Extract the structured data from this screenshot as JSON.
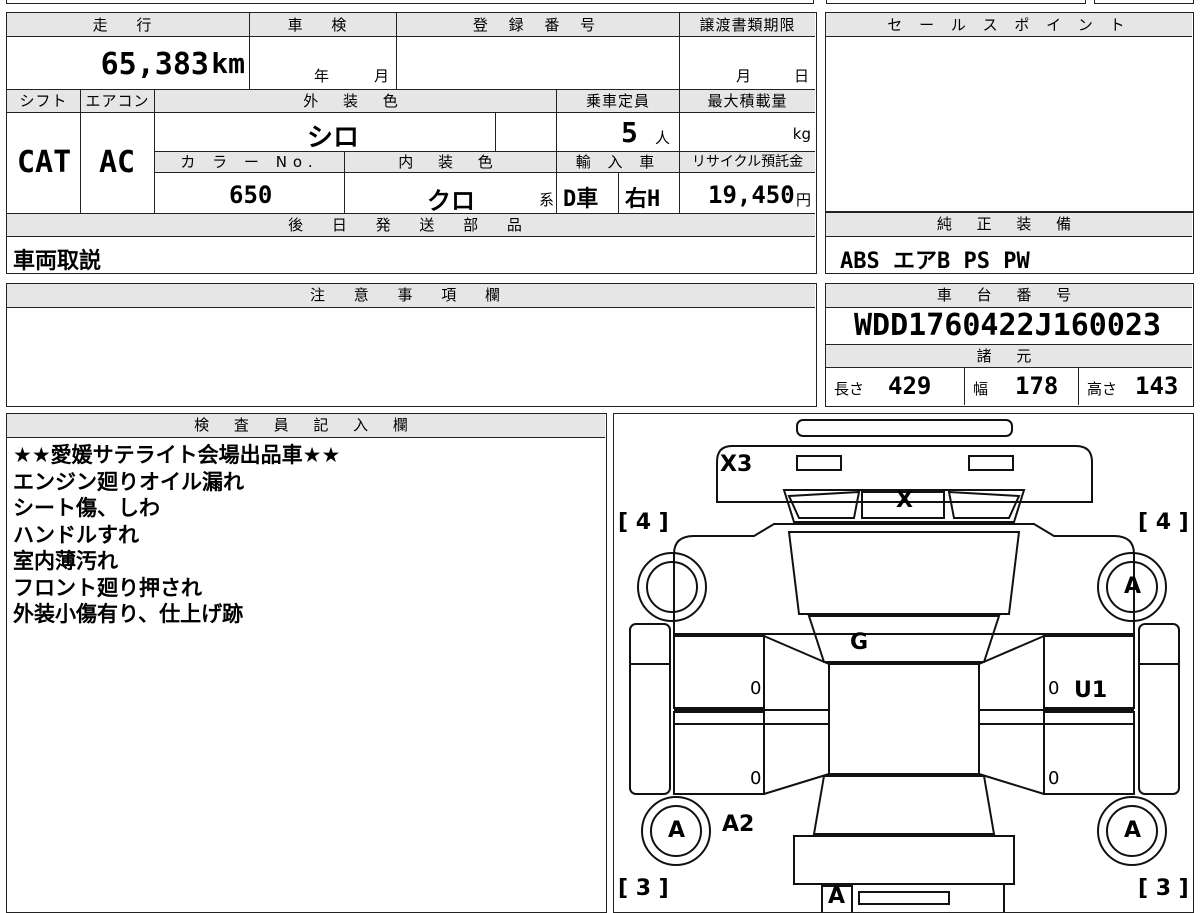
{
  "vehicle": {
    "mileage_label": "走 行",
    "mileage_value": "65,383",
    "mileage_unit": "km",
    "inspection_label": "車 検",
    "inspection_year": "年",
    "inspection_month": "月",
    "registration_label": "登 録 番 号",
    "transfer_deadline_label": "譲渡書類期限",
    "transfer_month": "月",
    "transfer_day": "日",
    "shift_label": "シフト",
    "shift_value": "CAT",
    "ac_label": "エアコン",
    "ac_value": "AC",
    "exterior_color_label": "外 装 色",
    "exterior_color_value": "シロ",
    "capacity_label": "乗車定員",
    "capacity_value": "5",
    "capacity_unit": "人",
    "max_load_label": "最大積載量",
    "max_load_unit": "kg",
    "color_no_label": "カ ラ ー No.",
    "color_no_value": "650",
    "interior_color_label": "内 装 色",
    "interior_color_value": "クロ",
    "interior_color_suffix": "系",
    "import_label": "輸 入 車",
    "import_value_1": "D車",
    "import_value_2": "右H",
    "recycle_label": "リサイクル預託金",
    "recycle_value": "19,450",
    "recycle_unit": "円"
  },
  "later_parts": {
    "label": "後 日 発 送 部 品",
    "value": "車両取説"
  },
  "sales_points": {
    "label": "セ ー ル ス ポ イ ン ト"
  },
  "equipment": {
    "label": "純 正 装 備",
    "value": "ABS エアB PS PW"
  },
  "notes_section": {
    "label": "注 意 事 項 欄"
  },
  "chassis": {
    "label": "車 台 番 号",
    "value": "WDD1760422J160023",
    "specs_label": "諸 元",
    "length_label": "長さ",
    "length_value": "429",
    "width_label": "幅",
    "width_value": "178",
    "height_label": "高さ",
    "height_value": "143"
  },
  "inspector": {
    "label": "検 査 員 記 入 欄",
    "lines": [
      "★★愛媛サテライト会場出品車★★",
      "エンジン廻りオイル漏れ",
      "シート傷、しわ",
      "ハンドルすれ",
      "室内薄汚れ",
      "フロント廻り押され",
      "外装小傷有り、仕上げ跡"
    ]
  },
  "diagram": {
    "marks": {
      "x3": "X3",
      "x": "X",
      "tire_fl": "[ 4 ]",
      "tire_fr": "[ 4 ]",
      "wheel_fr": "A",
      "g": "G",
      "u1": "U1",
      "door_l1": "0",
      "door_r1": "0",
      "door_l2": "0",
      "door_r2": "0",
      "wheel_rl": "A",
      "a2": "A2",
      "wheel_rr": "A",
      "tire_rl": "[ 3 ]",
      "tire_rr": "[ 3 ]",
      "rear_a": "A"
    }
  }
}
